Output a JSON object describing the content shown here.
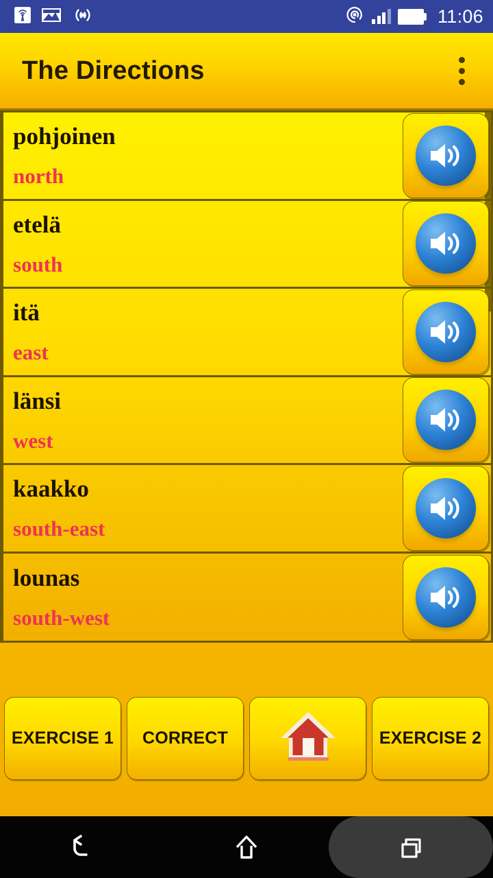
{
  "status_bar": {
    "background_color": "#33429B",
    "time": "11:06",
    "left_icons": [
      {
        "name": "broadcast-tower-icon"
      },
      {
        "name": "image-icon"
      },
      {
        "name": "wireless-signal-icon"
      }
    ],
    "right_icons": [
      {
        "name": "hotspot-icon"
      },
      {
        "name": "cellular-signal-icon",
        "bars_filled": 3,
        "bars_total": 4
      },
      {
        "name": "battery-icon",
        "level": "full"
      }
    ]
  },
  "action_bar": {
    "title": "The Directions",
    "overflow_menu_label": "More options",
    "gradient_top": "#FFE800",
    "gradient_bottom": "#F6AE00",
    "title_color": "#241A00"
  },
  "list": {
    "word_color": "#1C1200",
    "translation_color": "#EE3355",
    "divider_color": "#6E5A00",
    "speaker_button_name": "Play pronunciation",
    "items": [
      {
        "word": "pohjoinen",
        "translation": "north"
      },
      {
        "word": "etelä",
        "translation": "south"
      },
      {
        "word": "itä",
        "translation": "east"
      },
      {
        "word": "länsi",
        "translation": "west"
      },
      {
        "word": "kaakko",
        "translation": "south-east"
      },
      {
        "word": "lounas",
        "translation": "south-west"
      }
    ]
  },
  "bottom_bar": {
    "buttons": [
      {
        "label": "EXERCISE 1",
        "icon": null,
        "name": "exercise-1-button"
      },
      {
        "label": "CORRECT",
        "icon": null,
        "name": "correct-button"
      },
      {
        "label": "",
        "icon": "home-icon",
        "name": "home-button"
      },
      {
        "label": "EXERCISE 2",
        "icon": null,
        "name": "exercise-2-button"
      }
    ],
    "home_icon_color": "#C8372A"
  },
  "nav_bar": {
    "background_color": "#040404",
    "items": [
      {
        "name": "back-nav-icon",
        "label": "Back"
      },
      {
        "name": "home-nav-icon",
        "label": "Home"
      },
      {
        "name": "recents-nav-icon",
        "label": "Recents",
        "highlighted": true
      }
    ]
  }
}
